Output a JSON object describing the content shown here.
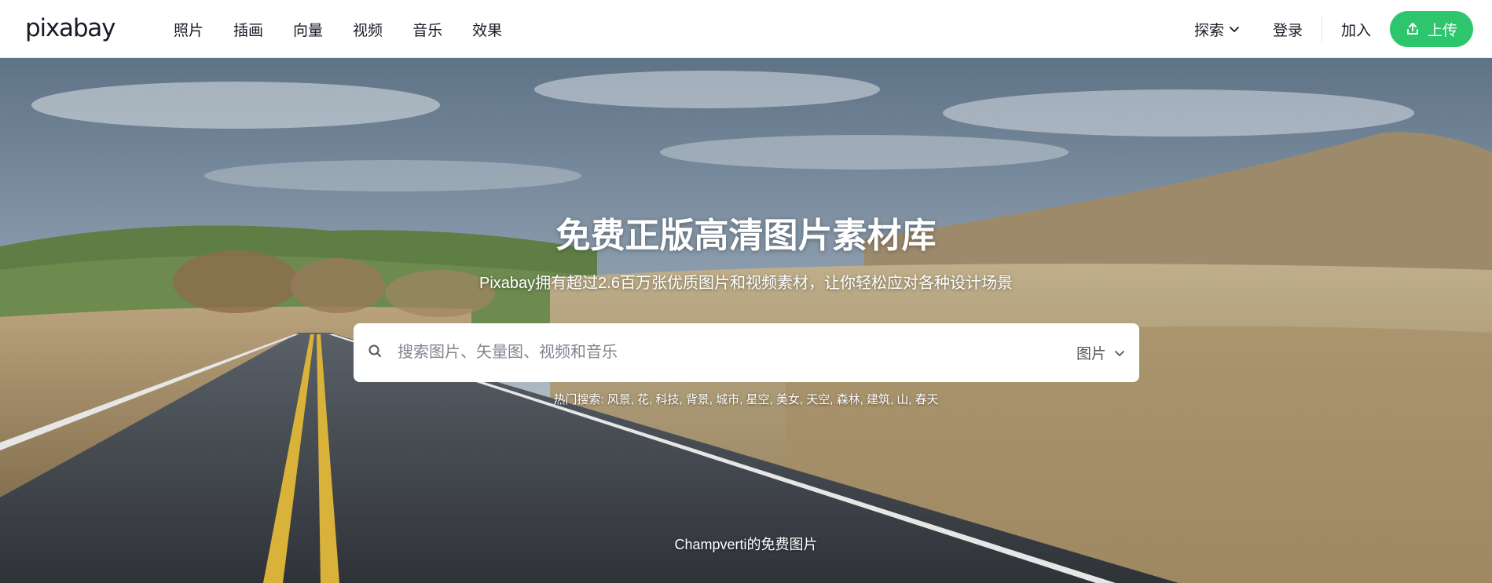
{
  "header": {
    "logo": "pixabay",
    "nav": [
      {
        "label": "照片"
      },
      {
        "label": "插画"
      },
      {
        "label": "向量"
      },
      {
        "label": "视频"
      },
      {
        "label": "音乐"
      },
      {
        "label": "效果"
      }
    ],
    "explore_label": "探索",
    "login_label": "登录",
    "join_label": "加入",
    "upload_label": "上传"
  },
  "hero": {
    "title": "免费正版高清图片素材库",
    "subtitle": "Pixabay拥有超过2.6百万张优质图片和视频素材，让你轻松应对各种设计场景",
    "search": {
      "placeholder": "搜索图片、矢量图、视频和音乐",
      "value": "",
      "type_label": "图片"
    },
    "hot_searches": {
      "label": "热门搜索:",
      "items": [
        "风景",
        "花",
        "科技",
        "背景",
        "城市",
        "星空",
        "美女",
        "天空",
        "森林",
        "建筑",
        "山",
        "春天"
      ]
    },
    "credit": "Champverti的免费图片"
  },
  "colors": {
    "accent": "#2ec66d",
    "text": "#191b26",
    "placeholder": "#82848f"
  },
  "icons": [
    "search-icon",
    "chevron-down-icon",
    "upload-icon"
  ]
}
